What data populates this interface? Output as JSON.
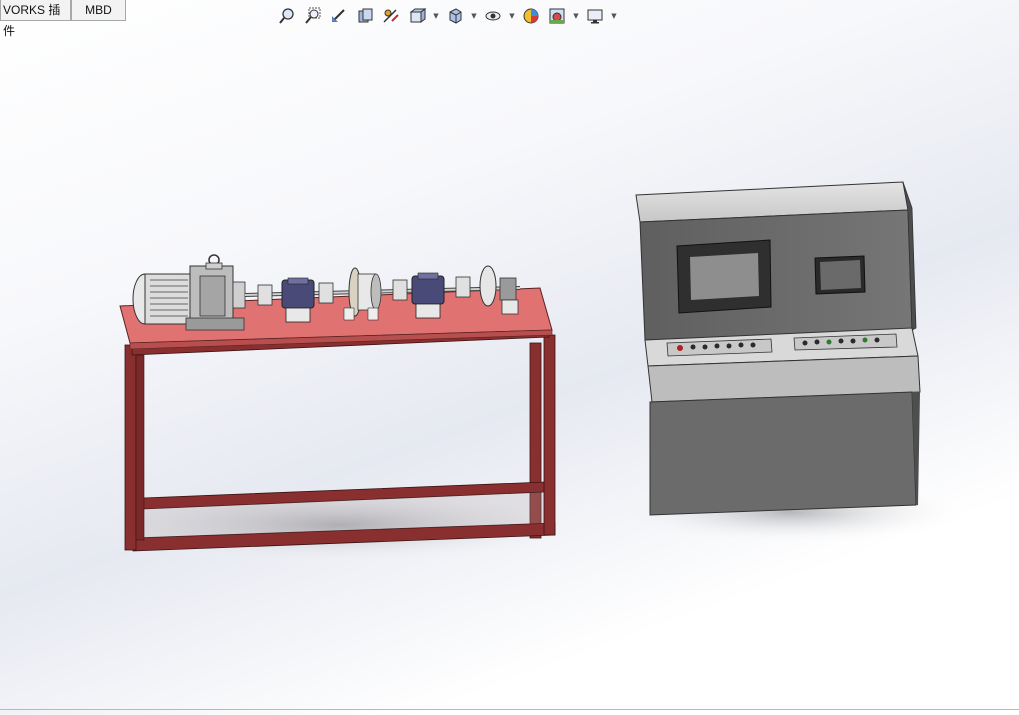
{
  "tabs": [
    {
      "label": "VORKS 插件"
    },
    {
      "label": "MBD"
    }
  ],
  "toolbar": {
    "icons": [
      "zoom-to-fit-icon",
      "zoom-area-icon",
      "previous-view-icon",
      "section-view-icon",
      "dynamic-annotation-icon",
      "view-orientation-icon",
      "display-style-icon",
      "hide-show-icon",
      "edit-appearance-icon",
      "apply-scene-icon",
      "view-settings-icon"
    ]
  },
  "colors": {
    "table_top": "#e07272",
    "frame": "#8a2f2f",
    "cabinet": "#6f6f6f",
    "cabinet_light": "#d9d9d9",
    "screen": "#8e8e8e"
  }
}
